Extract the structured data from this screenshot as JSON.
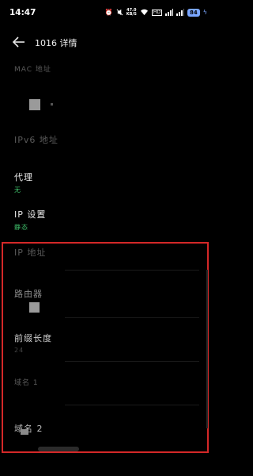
{
  "status_bar": {
    "time": "14:47",
    "speed_value": "47.0",
    "speed_unit": "KB/S",
    "battery": "84"
  },
  "header": {
    "title": "1016 详情"
  },
  "rows": {
    "mac": {
      "label": "MAC 地址"
    },
    "ipv6": {
      "label": "IPv6 地址"
    },
    "proxy": {
      "label": "代理",
      "value": "无"
    },
    "ip_settings": {
      "label": "IP 设置",
      "value": "静态"
    },
    "ip_address": {
      "label": "IP 地址"
    },
    "router": {
      "label": "路由器"
    },
    "prefix_length": {
      "label": "前缀长度",
      "value": "24"
    },
    "dns1": {
      "label": "域名 1"
    },
    "dns2": {
      "label": "域名 2"
    }
  },
  "colors": {
    "accent_green": "#3fbf6a",
    "annotation_red": "#d42828",
    "battery_blue": "#7aa6ff",
    "background": "#000000"
  }
}
